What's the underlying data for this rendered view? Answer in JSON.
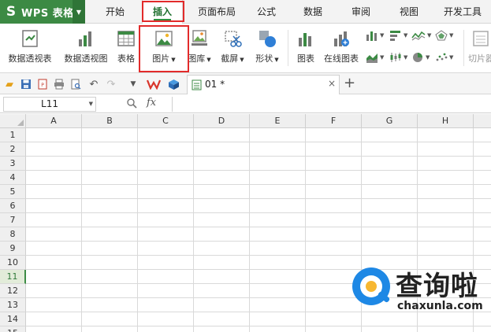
{
  "app": {
    "logo": "S",
    "name": "WPS 表格",
    "dropdown_icon": "caret-down-icon"
  },
  "tabs": [
    {
      "label": "开始"
    },
    {
      "label": "插入",
      "active": true
    },
    {
      "label": "页面布局"
    },
    {
      "label": "公式"
    },
    {
      "label": "数据"
    },
    {
      "label": "审阅"
    },
    {
      "label": "视图"
    },
    {
      "label": "开发工具"
    }
  ],
  "ribbon": {
    "pivot_table": "数据透视表",
    "pivot_chart": "数据透视图",
    "table": "表格",
    "picture": "图片",
    "gallery": "图库",
    "screenshot": "截屏",
    "shapes": "形状",
    "chart": "图表",
    "online_chart": "在线图表",
    "slicer": "切片器"
  },
  "document": {
    "name": "01 *",
    "close": "×",
    "new_tab": "+"
  },
  "formula_bar": {
    "cell_ref": "L11",
    "fx": "fx",
    "value": ""
  },
  "sheet": {
    "columns": [
      "A",
      "B",
      "C",
      "D",
      "E",
      "F",
      "G",
      "H"
    ],
    "rows": [
      "1",
      "2",
      "3",
      "4",
      "5",
      "6",
      "7",
      "8",
      "9",
      "10",
      "11",
      "12",
      "13",
      "14",
      "15"
    ],
    "active_row": "11"
  },
  "watermark": {
    "chinese": "查询啦",
    "domain": "chaxunla.com"
  },
  "colors": {
    "accent_green": "#3c8a44",
    "highlight_red": "#e22b2b",
    "watermark_blue": "#1e88e5"
  }
}
